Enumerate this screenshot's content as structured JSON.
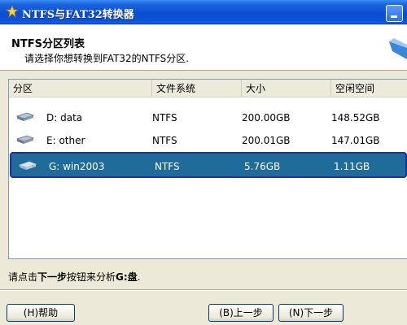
{
  "window": {
    "title": "NTFS与FAT32转换器"
  },
  "header": {
    "title": "NTFS分区列表",
    "subtitle": "请选择你想转换到FAT32的NTFS分区."
  },
  "table": {
    "columns": [
      "分区",
      "文件系统",
      "大小",
      "空闲空间"
    ],
    "rows": [
      {
        "partition": "D: data",
        "fs": "NTFS",
        "size": "200.00GB",
        "free": "148.52GB"
      },
      {
        "partition": "E: other",
        "fs": "NTFS",
        "size": "200.01GB",
        "free": "147.01GB"
      },
      {
        "partition": "G: win2003",
        "fs": "NTFS",
        "size": "5.76GB",
        "free": "1.11GB"
      }
    ],
    "selected_index": 2
  },
  "status": {
    "prefix": "请点击",
    "bold1": "下一步",
    "middle": "按钮来分析",
    "bold2": "G:盘",
    "suffix": "."
  },
  "buttons": {
    "help": "(H)帮助",
    "back": "(B)上一步",
    "next": "(N)下一步"
  },
  "colors": {
    "titlebar": "#0a4fd2",
    "selection": "#1f6c9a"
  }
}
